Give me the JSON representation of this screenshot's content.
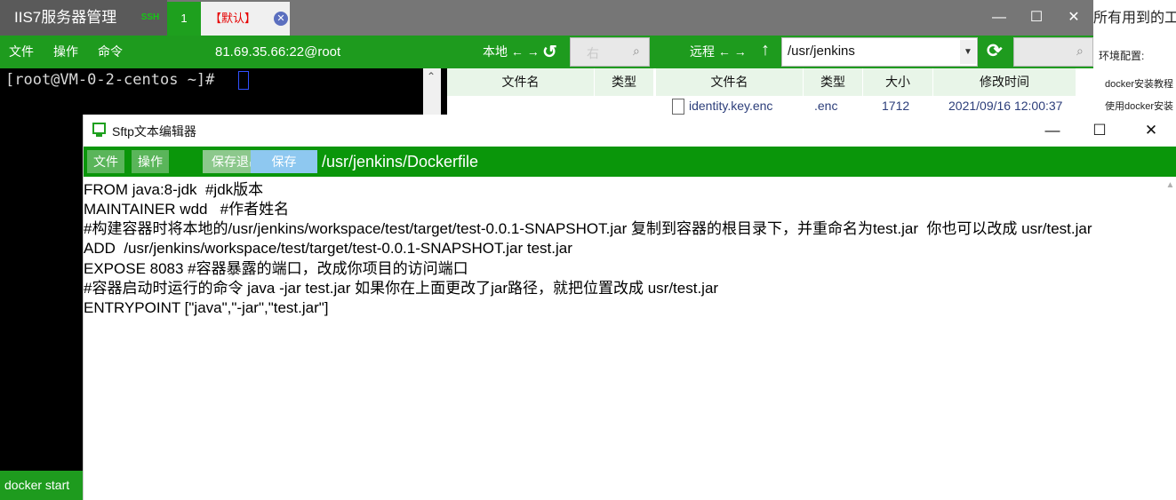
{
  "app": {
    "title": "IIS7服务器管理",
    "ssh_tag": "SSH",
    "tabs": [
      {
        "label": "1"
      },
      {
        "label": "【默认】"
      }
    ],
    "window_controls": {
      "minimize": "—",
      "maximize": "☐",
      "close": "✕"
    }
  },
  "toolbar": {
    "menu": [
      "文件",
      "操作",
      "命令"
    ],
    "host": "81.69.35.66:22@root",
    "local_label": "本地 ← →",
    "local_search_placeholder": "右",
    "remote_label": "远程 ← →",
    "remote_path": "/usr/jenkins"
  },
  "terminal": {
    "prompt": "[root@VM-0-2-centos ~]# ",
    "status": "docker start"
  },
  "local_pane": {
    "columns": [
      "文件名",
      "类型"
    ]
  },
  "remote_pane": {
    "columns": [
      "文件名",
      "类型",
      "大小",
      "修改时间"
    ],
    "rows": [
      {
        "name": "identity.key.enc",
        "type": ".enc",
        "size": "1712",
        "modified": "2021/09/16 12:00:37"
      }
    ]
  },
  "side_notes": {
    "heading": "所有用到的工",
    "env_label": "环境配置:",
    "items": [
      "docker安装教程",
      "使用docker安装"
    ]
  },
  "editor": {
    "title": "Sftp文本编辑器",
    "buttons": {
      "file": "文件",
      "ops": "操作",
      "save_exit": "保存退出",
      "save": "保存"
    },
    "path": "/usr/jenkins/Dockerfile",
    "lines": [
      "FROM java:8-jdk  #jdk版本",
      "MAINTAINER wdd   #作者姓名",
      "#构建容器时将本地的/usr/jenkins/workspace/test/target/test-0.0.1-SNAPSHOT.jar 复制到容器的根目录下，并重命名为test.jar  你也可以改成 usr/test.jar",
      "ADD  /usr/jenkins/workspace/test/target/test-0.0.1-SNAPSHOT.jar test.jar",
      "EXPOSE 8083 #容器暴露的端口，改成你项目的访问端口",
      "#容器启动时运行的命令 java -jar test.jar 如果你在上面更改了jar路径，就把位置改成 usr/test.jar",
      "ENTRYPOINT [\"java\",\"-jar\",\"test.jar\"]"
    ]
  },
  "colors": {
    "toolbar_green": "#1e9b1e",
    "editor_toolbar_green": "#0a960a",
    "tab_active_red": "#e60000",
    "titlebar_gray": "#767676"
  }
}
